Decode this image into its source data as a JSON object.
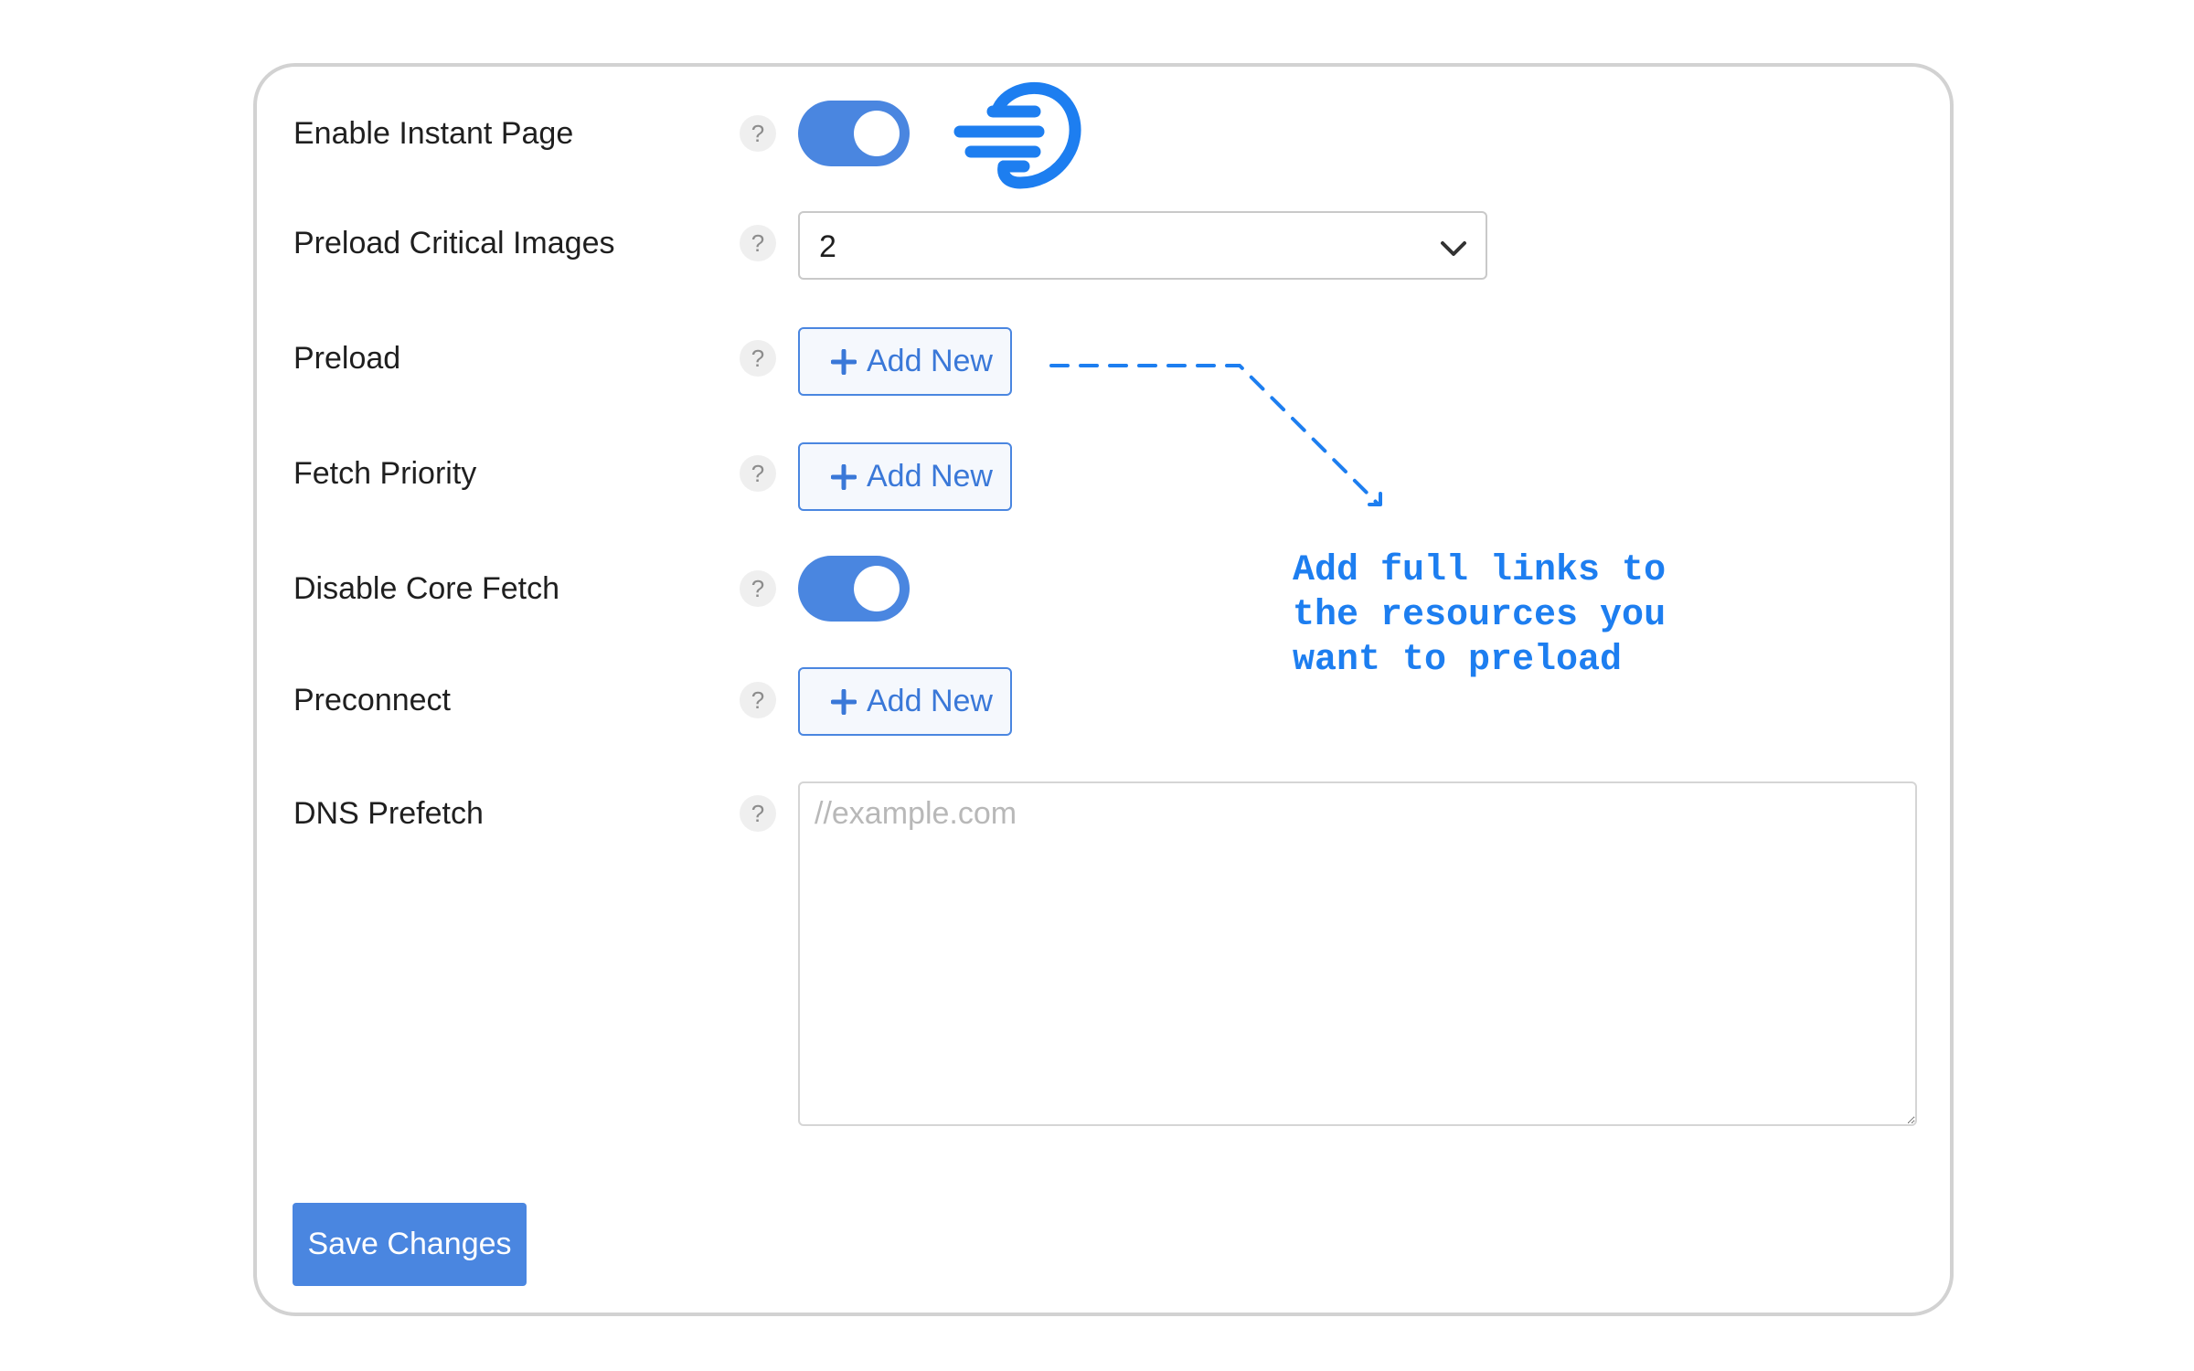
{
  "settings": {
    "enable_instant_page": {
      "label": "Enable Instant Page",
      "help": "?",
      "enabled": true
    },
    "preload_critical_images": {
      "label": "Preload Critical Images",
      "help": "?",
      "selected": "2"
    },
    "preload": {
      "label": "Preload",
      "help": "?",
      "button": "Add New"
    },
    "fetch_priority": {
      "label": "Fetch Priority",
      "help": "?",
      "button": "Add New"
    },
    "disable_core_fetch": {
      "label": "Disable Core Fetch",
      "help": "?",
      "enabled": true
    },
    "preconnect": {
      "label": "Preconnect",
      "help": "?",
      "button": "Add New"
    },
    "dns_prefetch": {
      "label": "DNS Prefetch",
      "help": "?",
      "value": "",
      "placeholder": "//example.com"
    }
  },
  "save_button": "Save Changes",
  "annotation": {
    "text": "Add full links to\nthe resources you\nwant to preload",
    "color": "#1d7ef0"
  },
  "icons": {
    "pointing_hand": "pointing-hand-icon",
    "help": "question-icon",
    "plus": "plus-icon",
    "chevron": "chevron-down-icon"
  },
  "colors": {
    "accent": "#4a86e0",
    "annotation": "#1d7ef0",
    "panel_border": "#d2d2d2"
  }
}
